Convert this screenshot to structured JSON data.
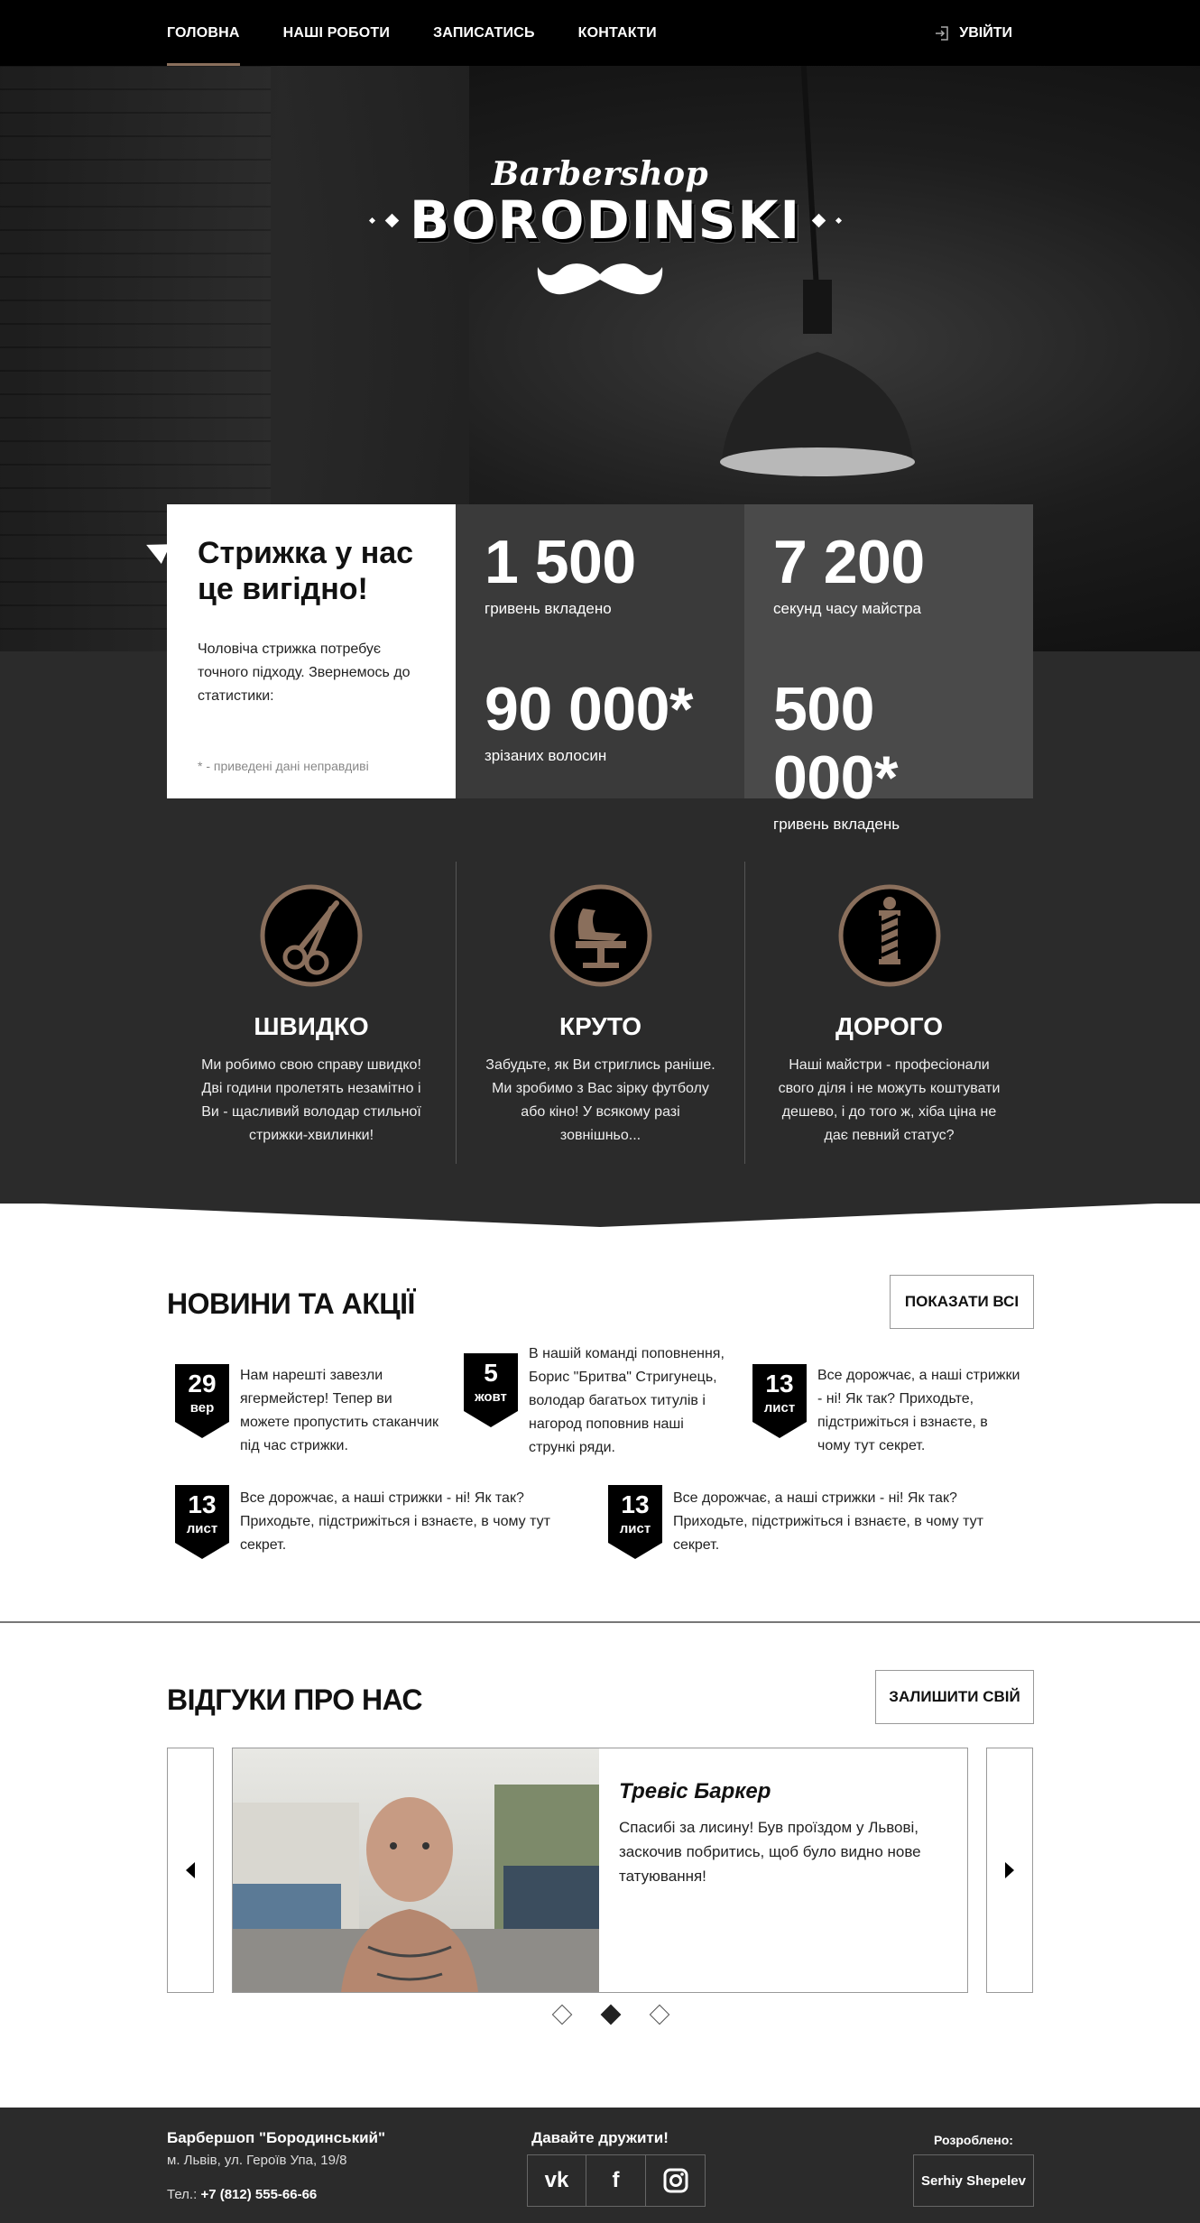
{
  "nav": {
    "items": [
      {
        "label": "ГОЛОВНА",
        "active": true
      },
      {
        "label": "НАШІ РОБОТИ",
        "active": false
      },
      {
        "label": "ЗАПИСАТИСЬ",
        "active": false
      },
      {
        "label": "КОНТАКТИ",
        "active": false
      }
    ],
    "login_label": "УВІЙТИ"
  },
  "logo": {
    "script": "Barbershop",
    "main": "BORODINSKI"
  },
  "stats": {
    "intro_title": "Стрижка у нас це вигідно!",
    "intro_text": "Чоловіча стрижка потребує точного підходу. Звернемось до статистики:",
    "intro_note": "* - приведені дані неправдиві",
    "items": [
      {
        "value": "1 500",
        "label": "гривень вкладено"
      },
      {
        "value": "7 200",
        "label": "секунд часу майстра"
      },
      {
        "value": "90 000*",
        "label": "зрізаних волосин"
      },
      {
        "value": "500 000*",
        "label": "гривень вкладень"
      }
    ]
  },
  "features": [
    {
      "icon": "scissors-icon",
      "title": "ШВИДКО",
      "text": "Ми робимо свою справу швидко! Дві години пролетять незамітно і Ви - щасливий володар стильної стрижки-хвилинки!"
    },
    {
      "icon": "barber-chair-icon",
      "title": "КРУТО",
      "text": "Забудьте, як Ви стриглись раніше. Ми зробимо з Вас зірку футболу або кіно! У всякому разі зовнішньо..."
    },
    {
      "icon": "barber-pole-icon",
      "title": "ДОРОГО",
      "text": "Наші майстри - професіонали свого діля і не можуть коштувати дешево, і до того ж, хіба ціна не дає певний статус?"
    }
  ],
  "news": {
    "title": "НОВИНИ ТА АКЦІЇ",
    "show_all_label": "ПОКАЗАТИ ВСІ",
    "items": [
      {
        "day": "29",
        "month": "вер",
        "text": "Нам нарешті завезли ягермейстер! Тепер ви можете пропустить стаканчик під час стрижки."
      },
      {
        "day": "5",
        "month": "жовт",
        "text": "В нашій команді поповнення, Борис \"Бритва\" Стригунець, володар багатьох титулів і нагород поповнив наші стрункі ряди."
      },
      {
        "day": "13",
        "month": "лист",
        "text": "Все дорожчає, а наші стрижки - ні! Як так? Приходьте, підстрижіться і взнаєте, в чому тут секрет."
      },
      {
        "day": "13",
        "month": "лист",
        "text": "Все дорожчає, а наші стрижки - ні! Як так? Приходьте, підстрижіться і взнаєте, в чому тут секрет."
      },
      {
        "day": "13",
        "month": "лист",
        "text": "Все дорожчає, а наші стрижки - ні! Як так? Приходьте, підстрижіться і взнаєте, в чому тут секрет."
      }
    ]
  },
  "reviews": {
    "title": "ВІДГУКИ ПРО НАС",
    "leave_label": "ЗАЛИШИТИ СВІЙ",
    "current": {
      "name": "Трeвіс Баркер",
      "text": "Спасибі за лисину! Був проїздом у Львові, заскочив побритись, щоб було видно нове татуювання!"
    },
    "dots": 3,
    "active_dot": 2
  },
  "footer": {
    "name": "Барбершоп \"Бородинський\"",
    "address": "м. Львів, ул. Героїв Упа, 19/8",
    "phone_label": "Тел.:",
    "phone": "+7 (812) 555-66-66",
    "social_title": "Давайте дружити!",
    "socials": [
      {
        "icon": "vk-icon",
        "label": "vk"
      },
      {
        "icon": "facebook-icon",
        "label": "f"
      },
      {
        "icon": "instagram-icon",
        "label": ""
      }
    ],
    "dev_title": "Розроблено:",
    "dev_name": "Serhiy Shepelev"
  },
  "colors": {
    "accent": "#8a6f5c",
    "dark": "#2b2b2b",
    "stat_dark": "#3a3a3a",
    "stat_light": "#4a4a4a"
  }
}
